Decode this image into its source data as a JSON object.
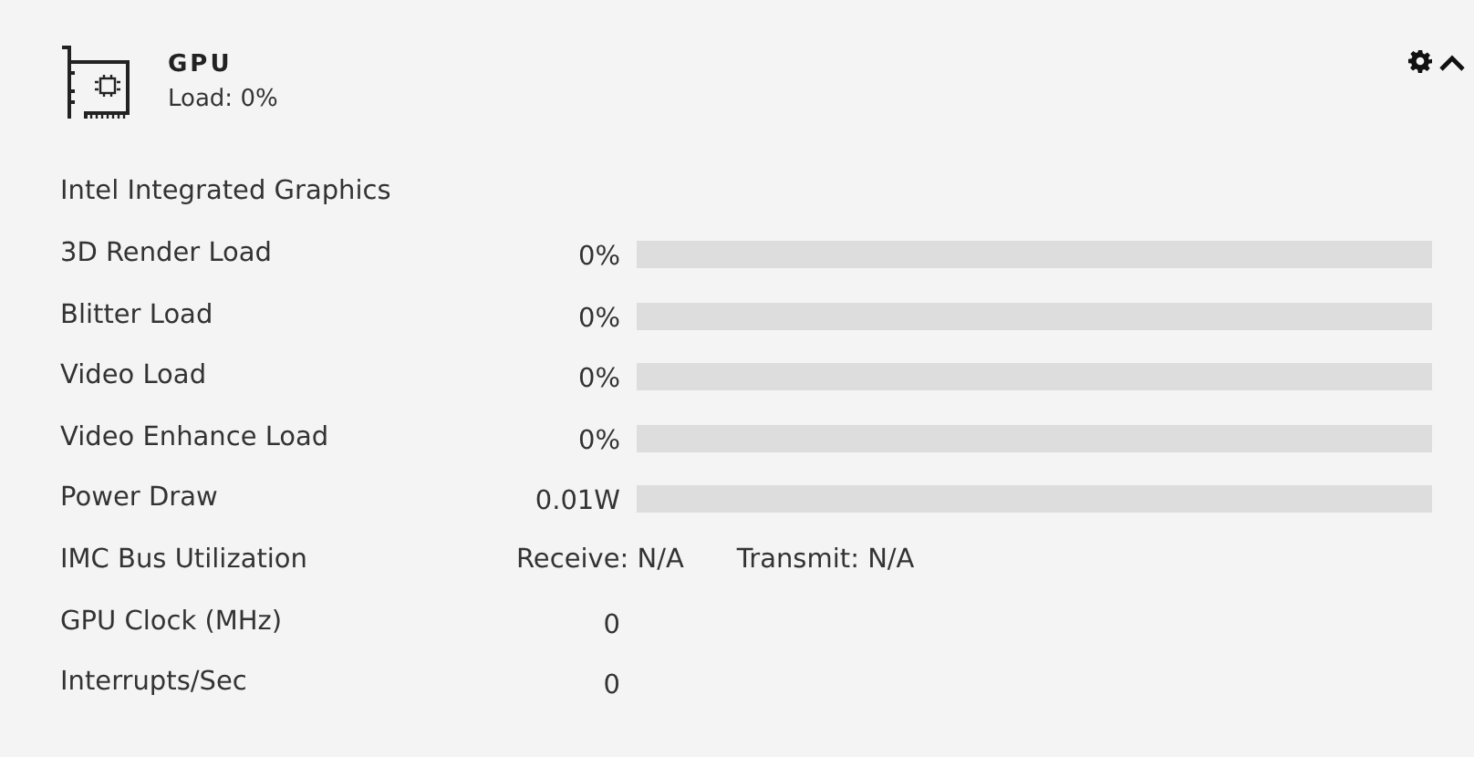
{
  "header": {
    "title": "GPU",
    "subtitle": "Load: 0%",
    "expanded": true
  },
  "device": "Intel Integrated Graphics",
  "rows": [
    {
      "kind": "bar",
      "label": "3D Render Load",
      "value": "0%",
      "level": 0
    },
    {
      "kind": "bar",
      "label": "Blitter Load",
      "value": "0%",
      "level": 0
    },
    {
      "kind": "bar",
      "label": "Video Load",
      "value": "0%",
      "level": 0
    },
    {
      "kind": "bar",
      "label": "Video Enhance Load",
      "value": "0%",
      "level": 0
    },
    {
      "kind": "bar",
      "label": "Power Draw",
      "value": "0.01W",
      "level": 0
    },
    {
      "kind": "pair",
      "label": "IMC Bus Utilization",
      "first": "Receive: N/A",
      "second": "Transmit: N/A"
    },
    {
      "kind": "value",
      "label": "GPU Clock (MHz)",
      "value": "0"
    },
    {
      "kind": "value",
      "label": "Interrupts/Sec",
      "value": "0"
    }
  ]
}
